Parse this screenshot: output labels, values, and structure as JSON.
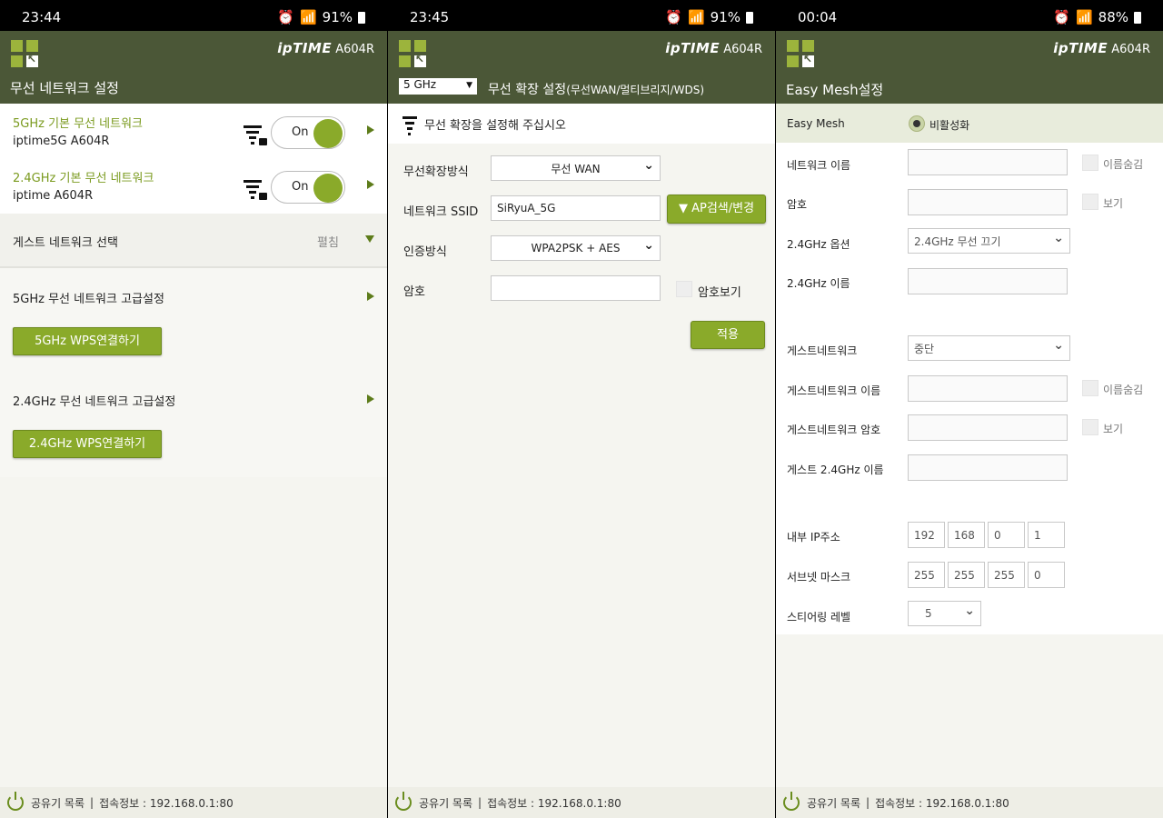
{
  "colors": {
    "header": "#4b5737",
    "accent": "#8aaa2a",
    "green_text": "#7a9a1e"
  },
  "screen1": {
    "status": {
      "time": "23:44",
      "battery": "91%"
    },
    "header": {
      "brand": "ipTIME",
      "model": "A604R",
      "title": "무선 네트워크 설정"
    },
    "net5": {
      "title": "5GHz 기본 무선 네트워크",
      "ssid": "iptime5G A604R",
      "toggle": "On"
    },
    "net24": {
      "title": "2.4GHz 기본 무선 네트워크",
      "ssid": "iptime A604R",
      "toggle": "On"
    },
    "guest": {
      "label": "게스트 네트워크 선택",
      "action": "펼침"
    },
    "adv5": {
      "label": "5GHz 무선 네트워크 고급설정",
      "button": "5GHz WPS연결하기"
    },
    "adv24": {
      "label": "2.4GHz 무선 네트워크 고급설정",
      "button": "2.4GHz WPS연결하기"
    },
    "footer": {
      "list": "공유기 목록",
      "info": "접속정보 : 192.168.0.1:80"
    }
  },
  "screen2": {
    "status": {
      "time": "23:45",
      "battery": "91%"
    },
    "header": {
      "brand": "ipTIME",
      "model": "A604R",
      "band": "5 GHz",
      "title": "무선 확장 설정",
      "title_sub": "(무선WAN/멀티브리지/WDS)"
    },
    "notice": "무선 확장을 설정해 주십시오",
    "form": {
      "mode_label": "무선확장방식",
      "mode_value": "무선 WAN",
      "ssid_label": "네트워크 SSID",
      "ssid_value": "SiRyuA_5G",
      "search_button": "AP검색/변경",
      "auth_label": "인증방식",
      "auth_value": "WPA2PSK + AES",
      "pw_label": "암호",
      "pw_value": "",
      "pw_show": "암호보기",
      "apply": "적용"
    },
    "footer": {
      "list": "공유기 목록",
      "info": "접속정보 : 192.168.0.1:80"
    }
  },
  "screen3": {
    "status": {
      "time": "00:04",
      "battery": "88%"
    },
    "header": {
      "brand": "ipTIME",
      "model": "A604R",
      "title": "Easy Mesh설정"
    },
    "mesh": {
      "label": "Easy Mesh",
      "value": "비활성화"
    },
    "rows": {
      "netname": "네트워크 이름",
      "hide1": "이름숨김",
      "pw": "암호",
      "show1": "보기",
      "opt24": "2.4GHz 옵션",
      "opt24_value": "2.4GHz 무선 끄기",
      "name24": "2.4GHz 이름",
      "guest": "게스트네트워크",
      "guest_value": "중단",
      "guest_name": "게스트네트워크 이름",
      "hide2": "이름숨김",
      "guest_pw": "게스트네트워크 암호",
      "show2": "보기",
      "guest24": "게스트 2.4GHz 이름",
      "ip": "내부 IP주소",
      "ip_values": [
        "192",
        "168",
        "0",
        "1"
      ],
      "mask": "서브넷 마스크",
      "mask_values": [
        "255",
        "255",
        "255",
        "0"
      ],
      "steer": "스티어링 레벨",
      "steer_value": "5"
    },
    "footer": {
      "list": "공유기 목록",
      "info": "접속정보 : 192.168.0.1:80"
    }
  }
}
